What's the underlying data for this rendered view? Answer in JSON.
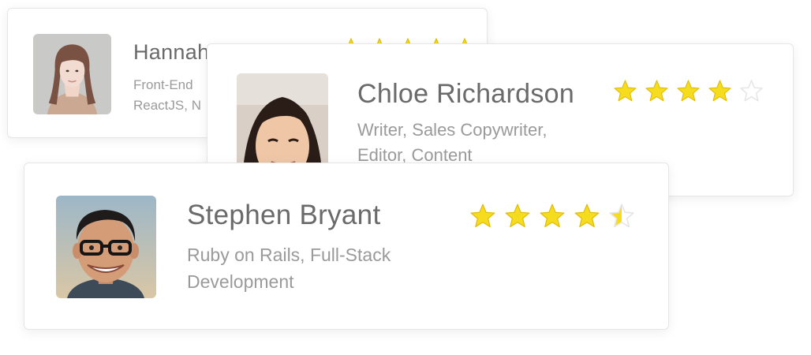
{
  "cards": [
    {
      "name": "Hannah",
      "skills_line1": "Front-End",
      "skills_line2": "ReactJS, N",
      "rating": 5,
      "avatar": "woman-with-braid-portrait"
    },
    {
      "name": "Chloe Richardson",
      "skills_line1": "Writer, Sales Copywriter,",
      "skills_line2": "Editor, Content",
      "rating": 4,
      "avatar": "woman-selfie-portrait"
    },
    {
      "name": "Stephen Bryant",
      "skills_line1": "Ruby on Rails, Full-Stack",
      "skills_line2": "Development",
      "rating": 4.5,
      "avatar": "man-with-glasses-portrait"
    }
  ],
  "colors": {
    "star_filled": "#F5DC1E",
    "star_outline": "#E2B800",
    "star_empty": "#E6E6E6",
    "name_text": "#6A6A6A",
    "skills_text": "#9A9A9A"
  }
}
